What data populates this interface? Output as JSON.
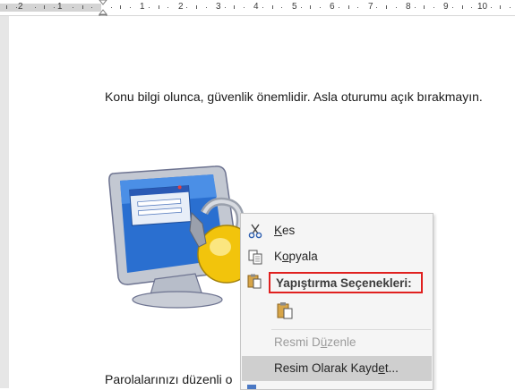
{
  "ruler": {
    "left_labels": [
      "2",
      "1"
    ],
    "right_labels": [
      "1",
      "2",
      "3",
      "4",
      "5",
      "6",
      "7",
      "8",
      "9",
      "10"
    ]
  },
  "document": {
    "paragraph_1": "Konu bilgi olunca, güvenlik önemlidir. Asla oturumu açık bırakmayın.",
    "paragraph_2": "Parolalarınızı düzenli o"
  },
  "context_menu": {
    "cut": {
      "pre": "",
      "u": "K",
      "post": "es",
      "icon": "scissors-icon"
    },
    "copy": {
      "pre": "K",
      "u": "o",
      "post": "pyala",
      "icon": "copy-icon"
    },
    "paste_options_header": "Yapıştırma Seçenekleri:",
    "paste_header_icon": "clipboard-icon",
    "paste_option_icon": "paste-keep-source-icon",
    "edit_picture": {
      "pre": "Resmi D",
      "u": "ü",
      "post": "zenle"
    },
    "save_as_picture": {
      "pre": "Resim Olarak Kayd",
      "u": "e",
      "post": "t..."
    }
  },
  "colors": {
    "highlight_border": "#e0201f",
    "menu_background": "#f5f5f5",
    "hover_row": "#cfcfcf"
  }
}
